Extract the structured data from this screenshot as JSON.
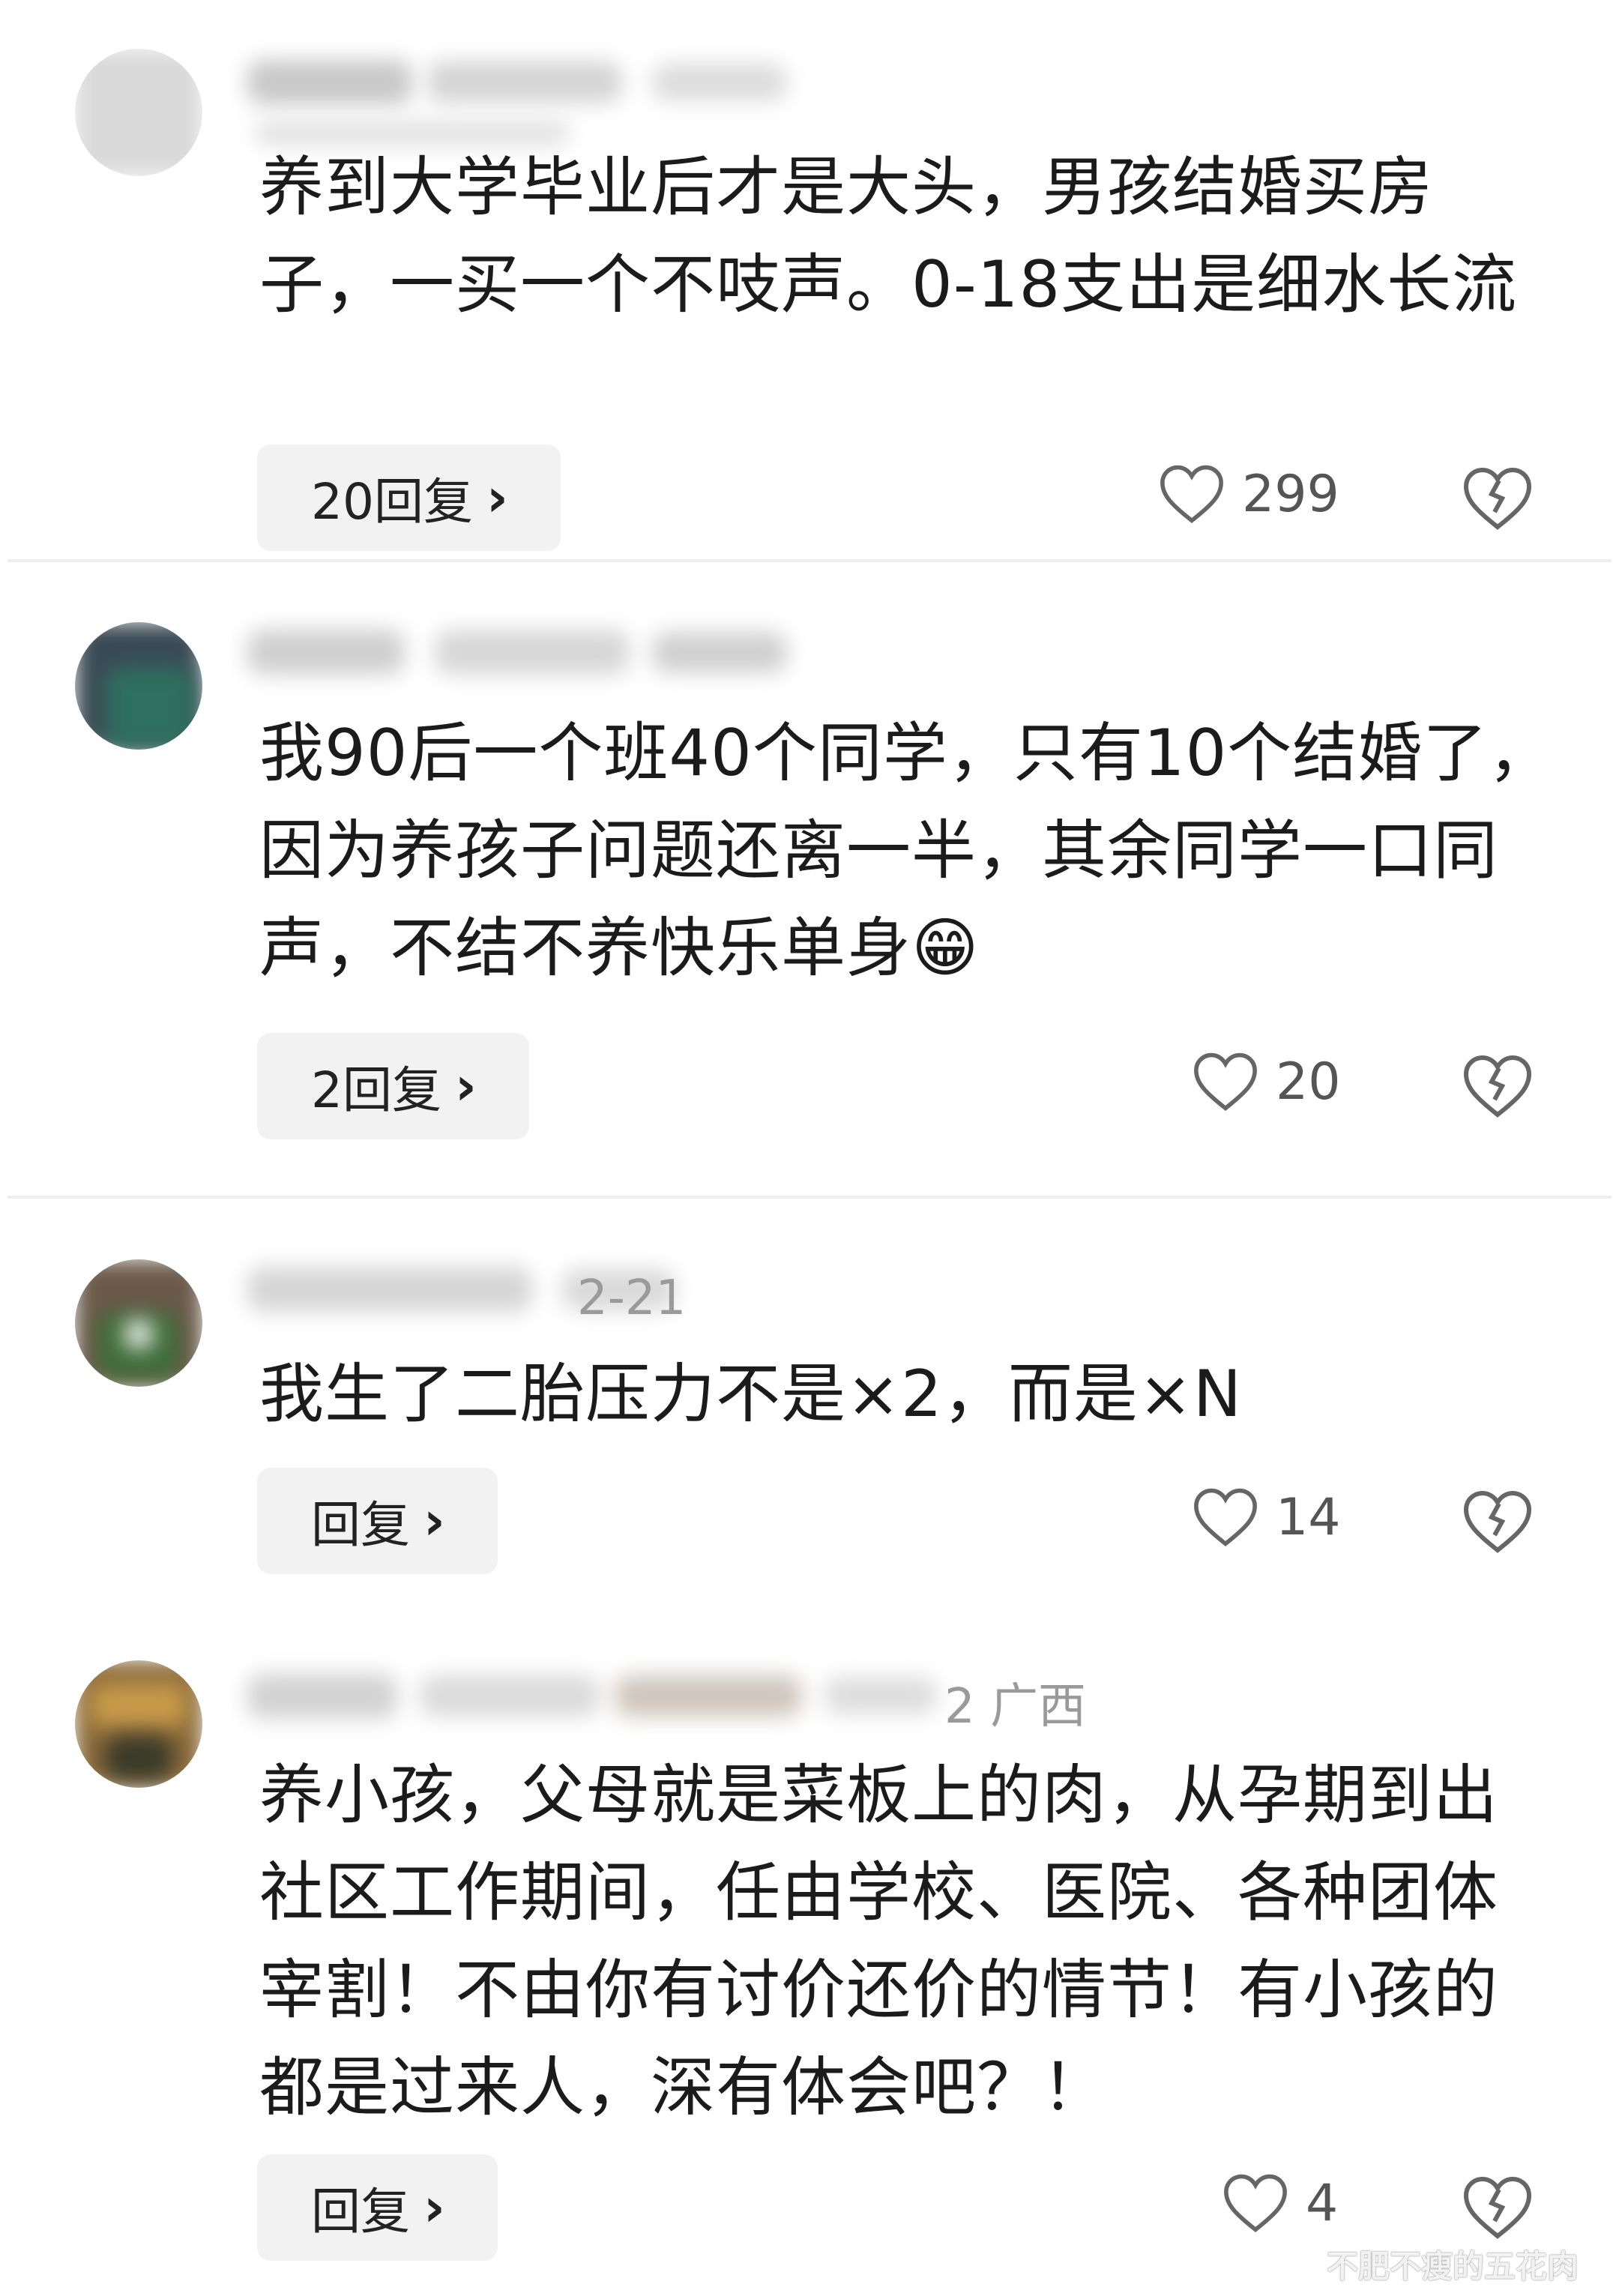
{
  "comments": [
    {
      "username": "",
      "meta": "",
      "text": "养到大学毕业后才是大头，男孩结婚买房子，一买一个不吱声。0-18支出是细水长流",
      "reply_label": "20回复",
      "likes": "299"
    },
    {
      "username": "",
      "meta": "",
      "text": "我90后一个班40个同学，只有10个结婚了，因为养孩子问题还离一半，其余同学一口同声，不结不养快乐单身😁",
      "reply_label": "2回复",
      "likes": "20"
    },
    {
      "username": "",
      "meta": "2-21",
      "text": "我生了二胎压力不是×2，而是×N",
      "reply_label": "回复",
      "likes": "14"
    },
    {
      "username": "",
      "meta": "2  广西",
      "text": "养小孩，父母就是菜板上的肉，从孕期到出社区工作期间，任由学校、医院、各种团体宰割！不由你有讨价还价的情节！有小孩的都是过来人，深有体会吧？！",
      "reply_label": "回复",
      "likes": "4"
    }
  ],
  "icons": {
    "like": "heart-outline-icon",
    "dislike": "broken-heart-icon",
    "reply_chevron": "chevron-right-icon"
  },
  "watermark": "不肥不瘦的五花肉",
  "colors": {
    "text": "#1b1b1b",
    "meta": "#9a9a9a",
    "reply_bg": "#f2f2f2",
    "icon": "#666666"
  }
}
